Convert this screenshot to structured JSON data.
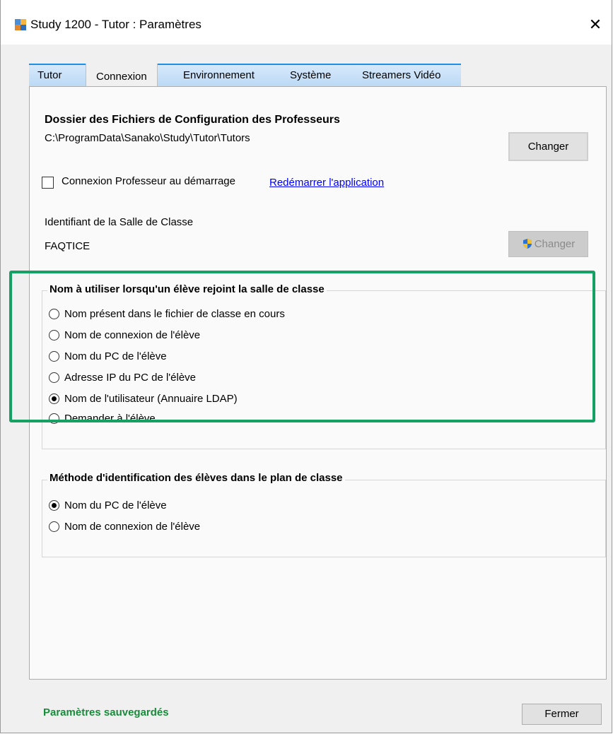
{
  "window": {
    "title": "Study 1200 - Tutor : Paramètres",
    "close_glyph": "✕"
  },
  "tabs": [
    {
      "label": "Tutor"
    },
    {
      "label": "Connexion"
    },
    {
      "label": "Environnement"
    },
    {
      "label": "Système"
    },
    {
      "label": "Streamers Vidéo"
    }
  ],
  "active_tab": "Connexion",
  "config_folder": {
    "heading": "Dossier des Fichiers de Configuration des Professeurs",
    "path": "C:\\ProgramData\\Sanako\\Study\\Tutor\\Tutors",
    "change_label": "Changer"
  },
  "teacher_login": {
    "checkbox_label": "Connexion Professeur au démarrage",
    "checked": false,
    "restart_link": "Redémarrer l'application"
  },
  "classroom": {
    "label": "Identifiant de la Salle de Classe",
    "value": "FAQTICE",
    "change_label": "Changer",
    "change_icon": "uac-shield-icon"
  },
  "student_name_group": {
    "title": "Nom à utiliser lorsqu'un élève rejoint la salle de classe",
    "options": [
      "Nom présent dans le fichier de classe en cours",
      "Nom de connexion de l'élève",
      "Nom du PC de l'élève",
      "Adresse IP du PC de l'élève",
      "Nom de l'utilisateur (Annuaire LDAP)",
      "Demander à l'élève"
    ],
    "selected_index": 4
  },
  "identification_group": {
    "title": "Méthode d'identification des élèves dans le plan de classe",
    "options": [
      "Nom du PC de l'élève",
      "Nom de connexion de l'élève"
    ],
    "selected_index": 0
  },
  "footer": {
    "status": "Paramètres sauvegardés",
    "close_label": "Fermer"
  },
  "colors": {
    "highlight": "#14a163",
    "status": "#1a8a3c",
    "tab_accent": "#1e8ee6",
    "link": "#0000ff"
  }
}
